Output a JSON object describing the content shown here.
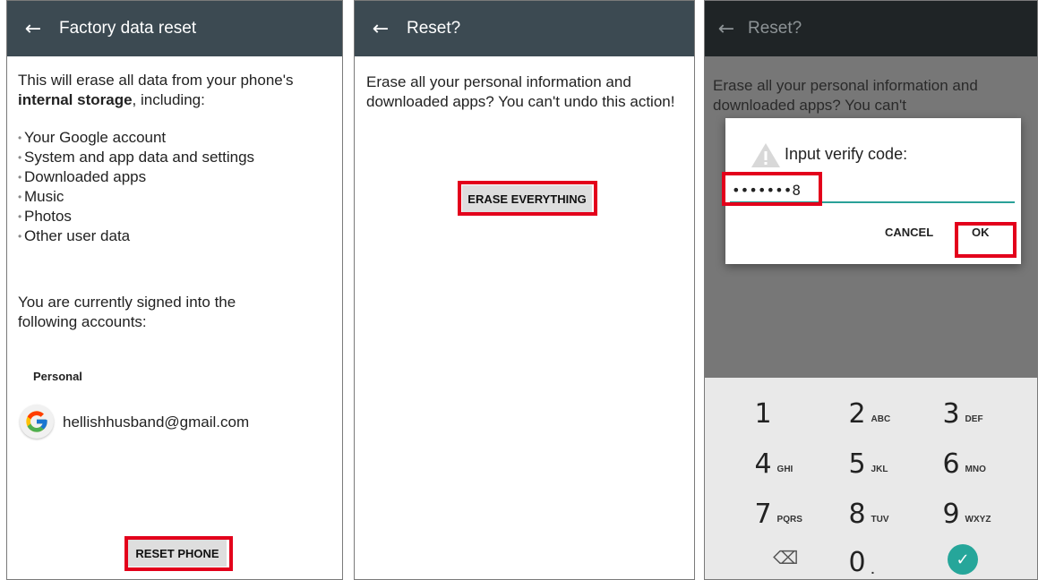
{
  "panel1": {
    "title": "Factory data reset",
    "intro_pre": "This will erase all data from your phone's",
    "intro_bold": "internal storage",
    "intro_post": ", including:",
    "items": [
      "Your Google account",
      "System and app data and settings",
      "Downloaded apps",
      "Music",
      "Photos",
      "Other user data"
    ],
    "signed_in_text": "You are currently signed into the following accounts:",
    "section_label": "Personal",
    "account_email": "hellishhusband@gmail.com",
    "reset_button": "RESET PHONE"
  },
  "panel2": {
    "title": "Reset?",
    "message": "Erase all your personal information and downloaded apps? You can't undo this action!",
    "erase_button": "ERASE EVERYTHING"
  },
  "panel3": {
    "title": "Reset?",
    "message_visible": "Erase all your personal information and downloaded apps? You can't",
    "dialog_title": "Input verify code:",
    "code_value": "•••••••8",
    "cancel_button": "CANCEL",
    "ok_button": "OK",
    "keys": [
      {
        "num": "1",
        "sub": ""
      },
      {
        "num": "2",
        "sub": "ABC"
      },
      {
        "num": "3",
        "sub": "DEF"
      },
      {
        "num": "4",
        "sub": "GHI"
      },
      {
        "num": "5",
        "sub": "JKL"
      },
      {
        "num": "6",
        "sub": "MNO"
      },
      {
        "num": "7",
        "sub": "PQRS"
      },
      {
        "num": "8",
        "sub": "TUV"
      },
      {
        "num": "9",
        "sub": "WXYZ"
      }
    ],
    "zero_key": "0",
    "zero_sub": ".",
    "icons": {
      "backspace": "backspace-icon",
      "done": "check-icon",
      "warning": "warning-icon",
      "back": "arrow-left-icon"
    }
  },
  "colors": {
    "appbar": "#3c4a52",
    "highlight": "#e3001b",
    "accent": "#26a69a"
  }
}
